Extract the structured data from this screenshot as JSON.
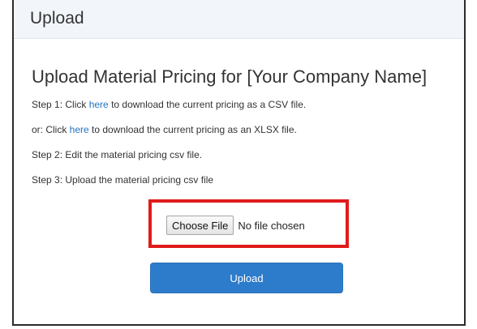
{
  "panel": {
    "title": "Upload"
  },
  "main": {
    "heading": "Upload Material Pricing for [Your Company Name]",
    "steps": [
      {
        "before": "Step 1: Click ",
        "link": "here",
        "after": " to download the current pricing as a CSV file."
      },
      {
        "before": "or: Click ",
        "link": "here",
        "after": " to download the current pricing as an XLSX file."
      },
      {
        "text": "Step 2: Edit the material pricing csv file."
      },
      {
        "text": "Step 3: Upload the material pricing csv file"
      }
    ],
    "file_input": {
      "button_label": "Choose File",
      "status": "No file chosen"
    },
    "upload_button_label": "Upload"
  },
  "colors": {
    "accent": "#2d7ccb",
    "link": "#1f73c4",
    "highlight": "#e01b1b",
    "header_bg": "#f2f6fa"
  }
}
